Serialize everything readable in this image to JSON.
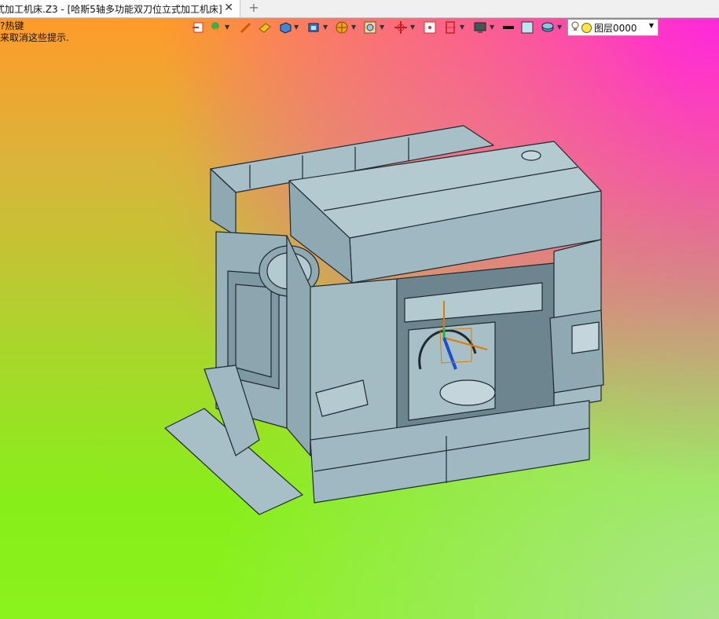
{
  "tab": {
    "title": "式加工机床.Z3 - [哈斯5轴多功能双刀位立式加工机床]",
    "close": "✕"
  },
  "new_tab": "+",
  "hints": {
    "line1": "?热键",
    "line2": "来取消这些提示."
  },
  "layer_selector": {
    "value": "图层0000",
    "bulb_color": "#ffe34a"
  },
  "colors": {
    "machine_body": "#9fb9c2",
    "machine_dark": "#7f99a3",
    "machine_light": "#c4d6dc",
    "edge": "#1e2a30"
  }
}
